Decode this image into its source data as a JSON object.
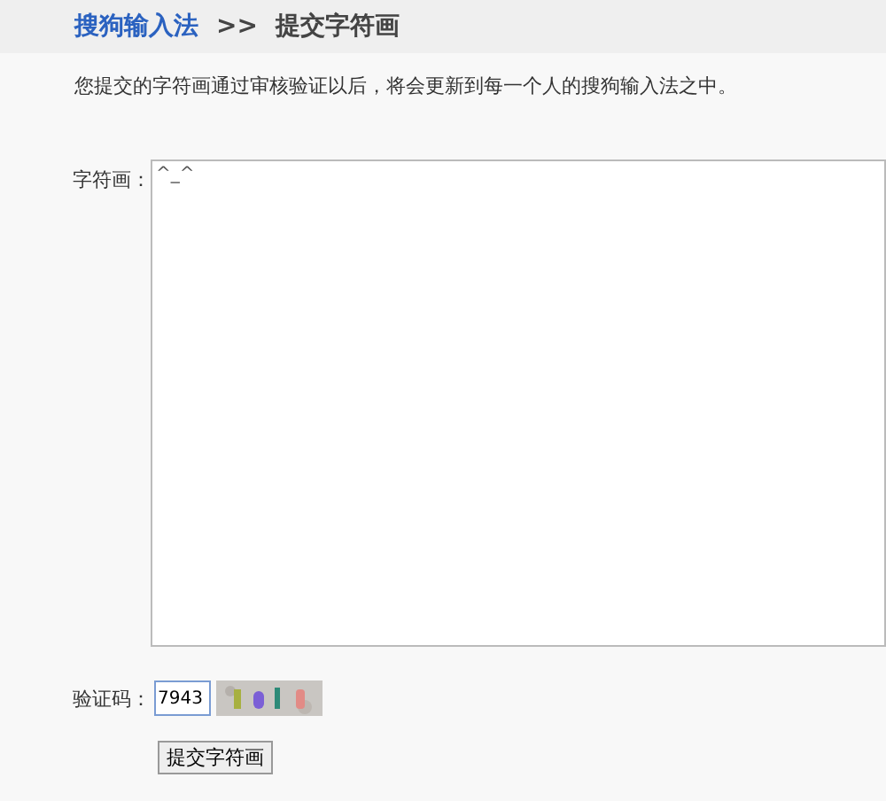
{
  "breadcrumb": {
    "home": "搜狗输入法",
    "separator": ">>",
    "current": "提交字符画"
  },
  "notice": "您提交的字符画通过审核验证以后，将会更新到每一个人的搜狗输入法之中。",
  "art_field": {
    "label": "字符画：",
    "value": "^_^"
  },
  "captcha": {
    "label": "验证码：",
    "value": "7943"
  },
  "submit": {
    "label": "提交字符画"
  }
}
